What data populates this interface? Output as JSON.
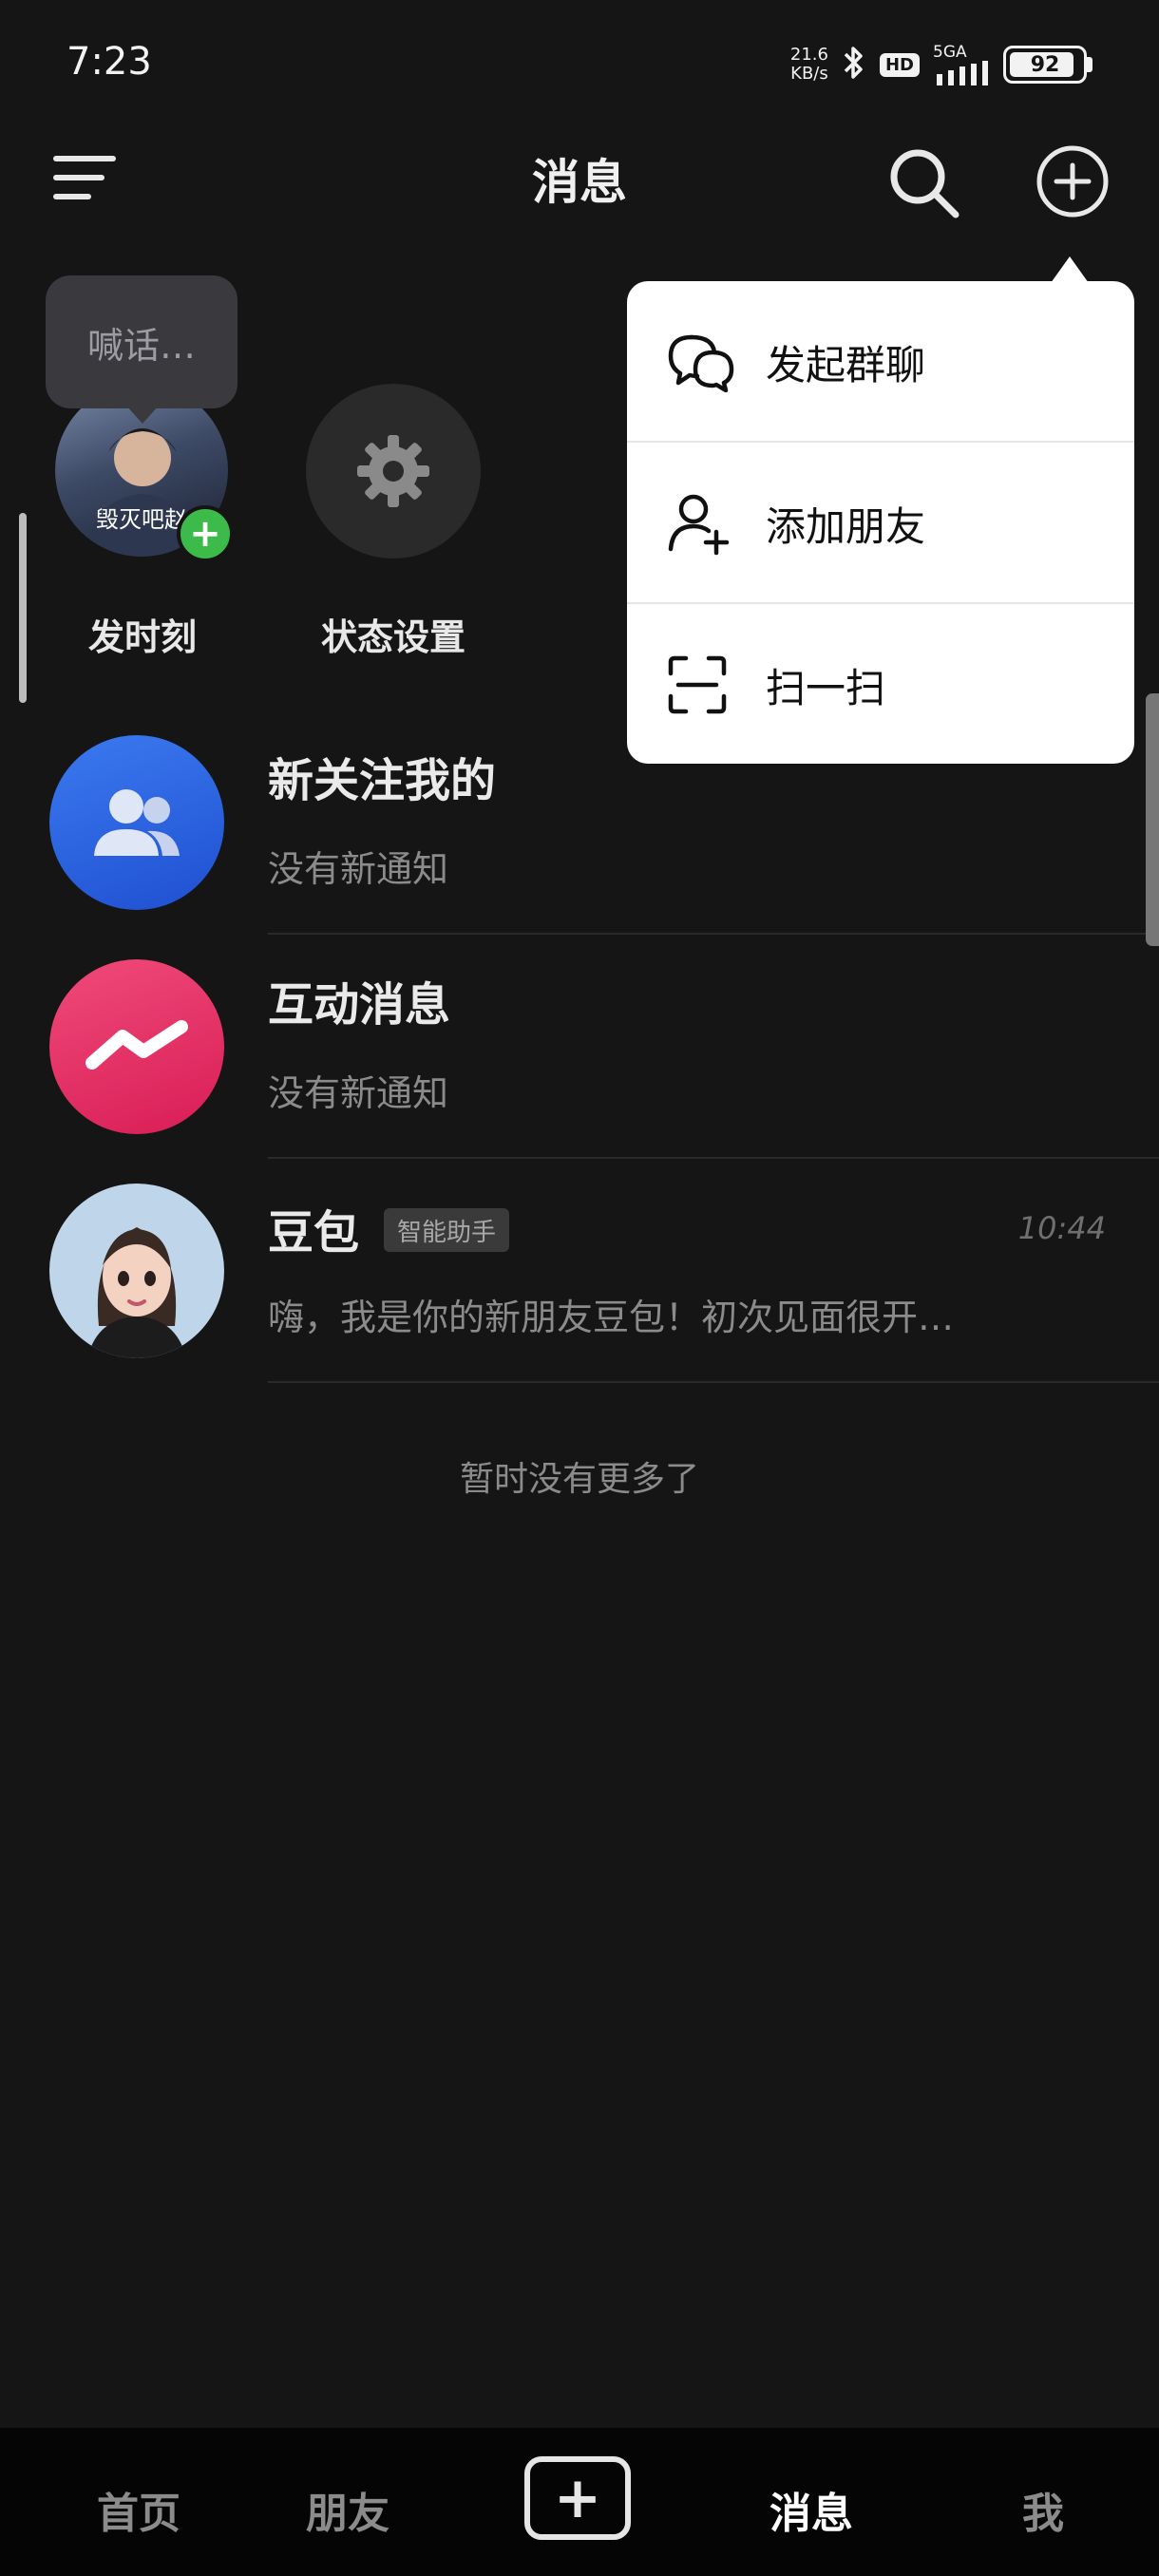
{
  "status_bar": {
    "time": "7:23",
    "net_speed_value": "21.6",
    "net_speed_unit": "KB/s",
    "hd_label": "HD",
    "signal_label": "5GA",
    "battery_level": "92"
  },
  "header": {
    "title": "消息"
  },
  "stories": {
    "bubble_text": "喊话…",
    "avatar_overlay_text": "毁灭吧赵",
    "add_badge": "+",
    "items": [
      {
        "label": "发时刻"
      },
      {
        "label": "状态设置"
      }
    ]
  },
  "dropdown_menu": {
    "items": [
      {
        "label": "发起群聊",
        "icon": "group-chat-icon"
      },
      {
        "label": "添加朋友",
        "icon": "add-friend-icon"
      },
      {
        "label": "扫一扫",
        "icon": "scan-icon"
      }
    ]
  },
  "messages": [
    {
      "title": "新关注我的",
      "subtitle": "没有新通知",
      "icon": "followers-icon",
      "color": "#2f64e0"
    },
    {
      "title": "互动消息",
      "subtitle": "没有新通知",
      "icon": "interaction-icon",
      "color": "#e23366"
    },
    {
      "title": "豆包",
      "tag": "智能助手",
      "subtitle": "嗨，我是你的新朋友豆包！初次见面很开…",
      "time": "10:44"
    }
  ],
  "list_footer": "暂时没有更多了",
  "bottom_nav": {
    "items": [
      {
        "label": "首页"
      },
      {
        "label": "朋友"
      },
      {
        "label": "+"
      },
      {
        "label": "消息"
      },
      {
        "label": "我"
      }
    ]
  },
  "colors": {
    "background": "#151515",
    "menu_background": "#ffffff",
    "add_badge": "#3dbb4a"
  }
}
